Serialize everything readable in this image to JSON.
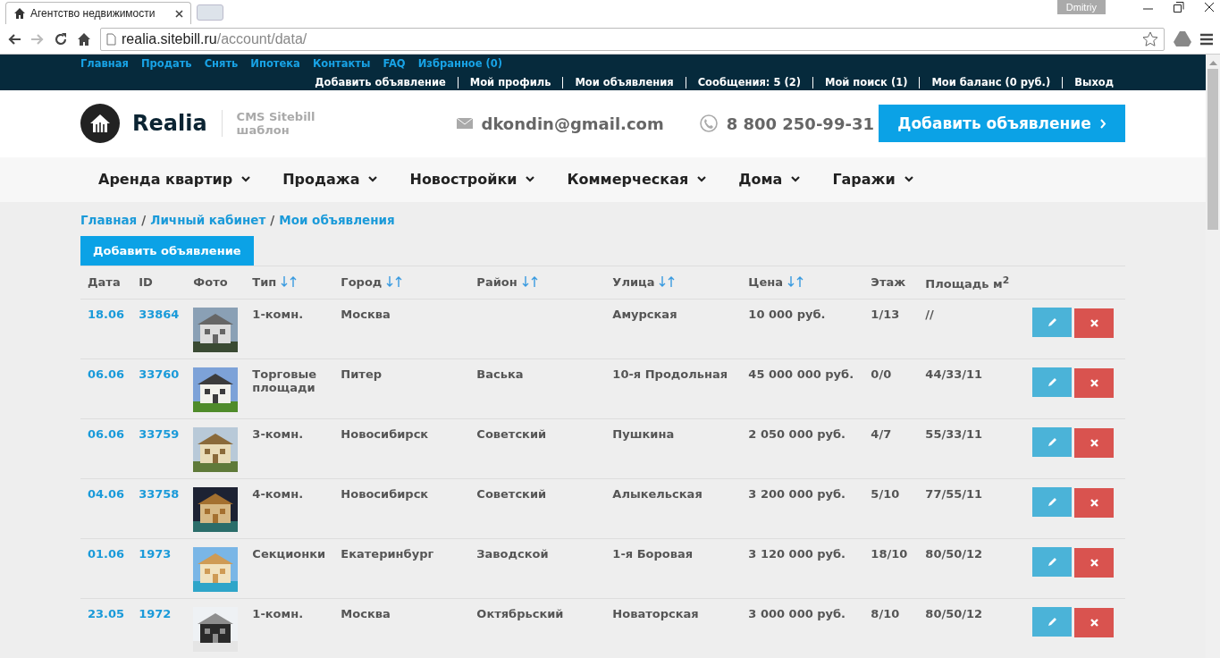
{
  "browser": {
    "tab_title": "Агентство недвижимости",
    "user": "Dmitriy",
    "url_host": "realia.sitebill.ru",
    "url_path": "/account/data/"
  },
  "top_links": [
    "Главная",
    "Продать",
    "Снять",
    "Ипотека",
    "Контакты",
    "FAQ",
    "Избранное (0)"
  ],
  "account_links": [
    "Добавить объявление",
    "Мой профиль",
    "Мои объявления",
    "Сообщения: 5 (2)",
    "Мой поиск (1)",
    "Мои баланс (0 руб.)",
    "Выход"
  ],
  "header": {
    "brand": "Realia",
    "tagline_1": "CMS Sitebill",
    "tagline_2": "шаблон",
    "email": "dkondin@gmail.com",
    "phone": "8 800 250-99-31",
    "cta": "Добавить объявление"
  },
  "nav": [
    "Аренда квартир",
    "Продажа",
    "Новостройки",
    "Коммерческая",
    "Дома",
    "Гаражи"
  ],
  "breadcrumbs": [
    "Главная",
    "Личный кабинет",
    "Мои объявления"
  ],
  "breadcrumb_separator": "/",
  "add_button": "Добавить объявление",
  "table": {
    "columns": [
      {
        "label": "Дата",
        "sortable": false
      },
      {
        "label": "ID",
        "sortable": false
      },
      {
        "label": "Фото",
        "sortable": false
      },
      {
        "label": "Тип",
        "sortable": true
      },
      {
        "label": "Город",
        "sortable": true
      },
      {
        "label": "Район",
        "sortable": true
      },
      {
        "label": "Улица",
        "sortable": true
      },
      {
        "label": "Цена",
        "sortable": true
      },
      {
        "label": "Этаж",
        "sortable": false
      },
      {
        "label": "Площадь м$^{2}$",
        "sortable": false
      }
    ],
    "rows": [
      {
        "date": "18.06",
        "id": "33864",
        "type": "1-комн.",
        "city": "Москва",
        "district": "",
        "street": "Амурская",
        "price": "10 000 руб.",
        "floor": "1/13",
        "area": "//"
      },
      {
        "date": "06.06",
        "id": "33760",
        "type": "Торговые площади",
        "city": "Питер",
        "district": "Васька",
        "street": "10-я Продольная",
        "price": "45 000 000 руб.",
        "floor": "0/0",
        "area": "44/33/11"
      },
      {
        "date": "06.06",
        "id": "33759",
        "type": "3-комн.",
        "city": "Новосибирск",
        "district": "Советский",
        "street": "Пушкина",
        "price": "2 050 000 руб.",
        "floor": "4/7",
        "area": "55/33/11"
      },
      {
        "date": "04.06",
        "id": "33758",
        "type": "4-комн.",
        "city": "Новосибирск",
        "district": "Советский",
        "street": "Алыкельская",
        "price": "3 200 000 руб.",
        "floor": "5/10",
        "area": "77/55/11"
      },
      {
        "date": "01.06",
        "id": "1973",
        "type": "Секционки",
        "city": "Екатеринбург",
        "district": "Заводской",
        "street": "1-я Боровая",
        "price": "3 120 000 руб.",
        "floor": "18/10",
        "area": "80/50/12"
      },
      {
        "date": "23.05",
        "id": "1972",
        "type": "1-комн.",
        "city": "Москва",
        "district": "Октябрьский",
        "street": "Новаторская",
        "price": "3 000 000 руб.",
        "floor": "8/10",
        "area": "80/50/12"
      }
    ]
  }
}
